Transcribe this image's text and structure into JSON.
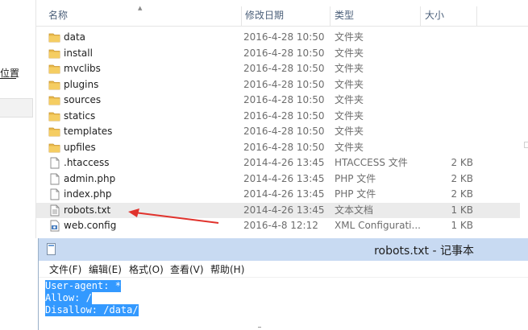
{
  "nav": {
    "partial_label": "位置"
  },
  "columns": {
    "name": "名称",
    "date": "修改日期",
    "type": "类型",
    "size": "大小"
  },
  "files": [
    {
      "name": "data",
      "date": "2016-4-28 10:50",
      "type": "文件夹",
      "size": "",
      "icon": "folder-icon"
    },
    {
      "name": "install",
      "date": "2016-4-28 10:50",
      "type": "文件夹",
      "size": "",
      "icon": "folder-icon"
    },
    {
      "name": "mvclibs",
      "date": "2016-4-28 10:50",
      "type": "文件夹",
      "size": "",
      "icon": "folder-icon"
    },
    {
      "name": "plugins",
      "date": "2016-4-28 10:50",
      "type": "文件夹",
      "size": "",
      "icon": "folder-icon"
    },
    {
      "name": "sources",
      "date": "2016-4-28 10:50",
      "type": "文件夹",
      "size": "",
      "icon": "folder-icon"
    },
    {
      "name": "statics",
      "date": "2016-4-28 10:50",
      "type": "文件夹",
      "size": "",
      "icon": "folder-icon"
    },
    {
      "name": "templates",
      "date": "2016-4-28 10:50",
      "type": "文件夹",
      "size": "",
      "icon": "folder-icon"
    },
    {
      "name": "upfiles",
      "date": "2016-4-28 10:50",
      "type": "文件夹",
      "size": "",
      "icon": "folder-icon"
    },
    {
      "name": ".htaccess",
      "date": "2014-4-26 13:45",
      "type": "HTACCESS 文件",
      "size": "2 KB",
      "icon": "file-icon"
    },
    {
      "name": "admin.php",
      "date": "2014-4-26 13:45",
      "type": "PHP 文件",
      "size": "2 KB",
      "icon": "file-icon"
    },
    {
      "name": "index.php",
      "date": "2014-4-26 13:45",
      "type": "PHP 文件",
      "size": "2 KB",
      "icon": "file-icon"
    },
    {
      "name": "robots.txt",
      "date": "2014-4-26 13:45",
      "type": "文本文档",
      "size": "1 KB",
      "icon": "text-file-icon",
      "selected": true
    },
    {
      "name": "web.config",
      "date": "2016-4-8 12:12",
      "type": "XML Configurati...",
      "size": "1 KB",
      "icon": "config-file-icon"
    }
  ],
  "notepad": {
    "title": "robots.txt - 记事本",
    "menu": [
      "文件(F)",
      "编辑(E)",
      "格式(O)",
      "查看(V)",
      "帮助(H)"
    ],
    "lines": [
      "User-agent: *",
      "Allow: /",
      "Disallow: /data/"
    ]
  },
  "colors": {
    "folder": "#e8b84a",
    "selection": "#3399ff",
    "arrow": "#e0322c",
    "titlebar": "#c8daf2"
  }
}
